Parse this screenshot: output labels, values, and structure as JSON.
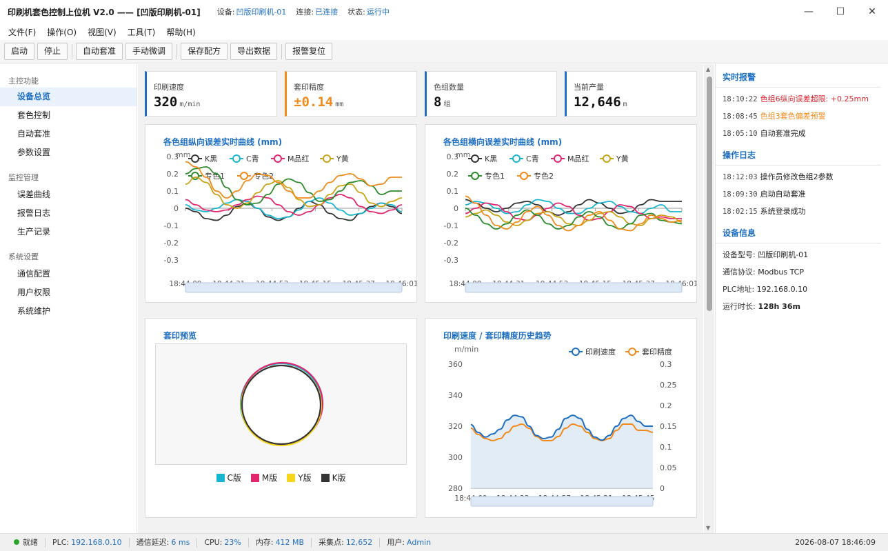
{
  "window": {
    "title": "印刷机套色控制上位机 V2.0 —— [凹版印刷机-01]",
    "device_label": "设备:",
    "device": "凹版印刷机-01",
    "conn_label": "连接:",
    "conn": "已连接",
    "state_label": "状态:",
    "state": "运行中",
    "min": "—",
    "max": "☐",
    "close": "✕"
  },
  "menu": [
    "文件(F)",
    "操作(O)",
    "视图(V)",
    "工具(T)",
    "帮助(H)"
  ],
  "toolbar": {
    "start": "启动",
    "stop": "停止",
    "auto": "自动套准",
    "manual": "手动微调",
    "save": "保存配方",
    "export": "导出数据",
    "reset": "报警复位"
  },
  "sidebar": {
    "g1": "主控功能",
    "i1": "设备总览",
    "i2": "套色控制",
    "i3": "自动套准",
    "i4": "参数设置",
    "g2": "监控管理",
    "i5": "误差曲线",
    "i6": "报警日志",
    "i7": "生产记录",
    "g3": "系统设置",
    "i8": "通信配置",
    "i9": "用户权限",
    "i10": "系统维护"
  },
  "kpis": [
    {
      "label": "印刷速度",
      "value": "320",
      "unit": "m/min",
      "color": "#1e6fc2",
      "value_color": "#111"
    },
    {
      "label": "套印精度",
      "value": "±0.14",
      "unit": "mm",
      "color": "#f08a1a",
      "value_color": "#f08a1a"
    },
    {
      "label": "色组数量",
      "value": "8",
      "unit": "组",
      "color": "#1e6fc2",
      "value_color": "#111"
    },
    {
      "label": "当前产量",
      "value": "12,646",
      "unit": "m",
      "color": "#1e6fc2",
      "value_color": "#111"
    }
  ],
  "chart_data": [
    {
      "type": "line",
      "title": "各色组纵向误差实时曲线 (mm)",
      "ylabel": "mm",
      "ylim": [
        -0.3,
        0.3
      ],
      "y_ticks": [
        "0.3",
        "0.2",
        "0.1",
        "0",
        "-0.1",
        "-0.2",
        "-0.3"
      ],
      "x_ticks": [
        "18:44:09",
        "18:44:31",
        "18:44:53",
        "18:45:15",
        "18:45:37",
        "18:46:01"
      ],
      "series_names": [
        "K黑",
        "C青",
        "M品红",
        "Y黄",
        "专色1",
        "专色2"
      ],
      "series_colors": [
        "#333333",
        "#19b4cf",
        "#e0266e",
        "#c9a317",
        "#2a8a2a",
        "#f08a1a"
      ],
      "series": [
        {
          "name": "K黑",
          "values": [
            0,
            -0.02,
            -0.06,
            -0.07,
            -0.04,
            0.01,
            0.03,
            0.0,
            -0.05,
            -0.07,
            -0.05,
            0.0,
            0.04,
            0.02,
            -0.03,
            -0.06,
            -0.07,
            -0.03,
            0.01,
            0.03,
            0.01,
            -0.03
          ]
        },
        {
          "name": "C青",
          "values": [
            0.02,
            -0.01,
            -0.02,
            0.0,
            0.03,
            0.05,
            0.04,
            0.0,
            -0.04,
            -0.06,
            -0.05,
            -0.01,
            0.04,
            0.06,
            0.03,
            -0.01,
            -0.04,
            -0.03,
            0.0,
            0.03,
            0.02,
            -0.02
          ]
        },
        {
          "name": "M品红",
          "values": [
            0.05,
            0.02,
            -0.01,
            -0.02,
            -0.01,
            0.02,
            0.05,
            0.07,
            0.06,
            0.02,
            -0.02,
            -0.04,
            -0.02,
            0.02,
            0.06,
            0.08,
            0.06,
            0.01,
            -0.02,
            -0.03,
            -0.01,
            0.02
          ]
        },
        {
          "name": "Y黄",
          "values": [
            0.14,
            0.18,
            0.15,
            0.08,
            0.02,
            0.0,
            0.03,
            0.09,
            0.14,
            0.16,
            0.12,
            0.05,
            0.01,
            0.02,
            0.08,
            0.13,
            0.14,
            0.09,
            0.03,
            0.01,
            0.04,
            0.06
          ]
        },
        {
          "name": "专色1",
          "values": [
            0.2,
            0.23,
            0.24,
            0.2,
            0.12,
            0.05,
            0.02,
            0.03,
            0.08,
            0.14,
            0.17,
            0.15,
            0.09,
            0.04,
            0.05,
            0.1,
            0.15,
            0.16,
            0.13,
            0.08,
            0.1,
            0.1
          ]
        },
        {
          "name": "专色2",
          "values": [
            0.27,
            0.24,
            0.18,
            0.1,
            0.06,
            0.1,
            0.16,
            0.2,
            0.19,
            0.15,
            0.1,
            0.06,
            0.06,
            0.1,
            0.15,
            0.19,
            0.2,
            0.17,
            0.13,
            0.14,
            0.18,
            0.18
          ]
        }
      ]
    },
    {
      "type": "line",
      "title": "各色组横向误差实时曲线 (mm)",
      "ylabel": "mm",
      "ylim": [
        -0.3,
        0.3
      ],
      "y_ticks": [
        "0.3",
        "0.2",
        "0.1",
        "0",
        "-0.1",
        "-0.2",
        "-0.3"
      ],
      "x_ticks": [
        "18:44:09",
        "18:44:31",
        "18:44:53",
        "18:45:15",
        "18:45:37",
        "18:46:01"
      ],
      "series_names": [
        "K黑",
        "C青",
        "M品红",
        "Y黄",
        "专色1",
        "专色2"
      ],
      "series_colors": [
        "#333333",
        "#19b4cf",
        "#e0266e",
        "#c9a317",
        "#2a8a2a",
        "#f08a1a"
      ],
      "series": [
        {
          "name": "K黑",
          "values": [
            0.05,
            0.03,
            0.0,
            -0.02,
            0.0,
            0.03,
            0.04,
            0.02,
            -0.02,
            -0.04,
            -0.02,
            0.02,
            0.05,
            0.03,
            0.0,
            -0.03,
            -0.02,
            0.02,
            0.05,
            0.04,
            0.04,
            0.04
          ]
        },
        {
          "name": "C青",
          "values": [
            0.02,
            0.04,
            0.03,
            0.0,
            -0.03,
            -0.02,
            0.02,
            0.05,
            0.04,
            0.0,
            -0.03,
            -0.03,
            0.0,
            0.03,
            0.04,
            0.01,
            -0.02,
            -0.03,
            0.0,
            0.02,
            -0.02,
            -0.02
          ]
        },
        {
          "name": "M品红",
          "values": [
            -0.03,
            0.0,
            0.03,
            0.02,
            -0.02,
            -0.06,
            -0.07,
            -0.04,
            0.0,
            0.03,
            0.01,
            -0.04,
            -0.07,
            -0.06,
            -0.02,
            0.02,
            0.01,
            -0.03,
            -0.06,
            -0.05,
            -0.06,
            -0.06
          ]
        },
        {
          "name": "Y黄",
          "values": [
            -0.05,
            -0.03,
            -0.01,
            -0.04,
            -0.08,
            -0.1,
            -0.07,
            -0.03,
            -0.02,
            -0.05,
            -0.09,
            -0.1,
            -0.07,
            -0.03,
            -0.02,
            -0.05,
            -0.09,
            -0.1,
            -0.06,
            -0.04,
            -0.05,
            -0.08
          ]
        },
        {
          "name": "专色1",
          "values": [
            0.0,
            -0.04,
            -0.09,
            -0.12,
            -0.09,
            -0.04,
            -0.01,
            -0.04,
            -0.09,
            -0.12,
            -0.1,
            -0.05,
            -0.02,
            -0.05,
            -0.1,
            -0.12,
            -0.09,
            -0.04,
            -0.03,
            -0.07,
            -0.08,
            -0.09
          ]
        },
        {
          "name": "专色2",
          "values": [
            0.07,
            0.03,
            -0.04,
            -0.1,
            -0.12,
            -0.08,
            -0.02,
            0.01,
            -0.04,
            -0.1,
            -0.13,
            -0.1,
            -0.04,
            -0.02,
            -0.07,
            -0.12,
            -0.13,
            -0.09,
            -0.04,
            -0.06,
            -0.08,
            -0.07
          ]
        }
      ]
    },
    {
      "type": "line",
      "title": "印刷速度 / 套印精度历史趋势",
      "ylabel": "m/min",
      "ylim": [
        280,
        360
      ],
      "y2lim": [
        0,
        0.3
      ],
      "y_ticks": [
        "360",
        "340",
        "320",
        "300",
        "280"
      ],
      "y2_ticks": [
        "0.3",
        "0.25",
        "0.2",
        "0.15",
        "0.1",
        "0.05",
        "0"
      ],
      "x_ticks": [
        "18:44:09",
        "18:44:33",
        "18:44:57",
        "18:45:21",
        "18:45:45"
      ],
      "series_names": [
        "印刷速度",
        "套印精度"
      ],
      "series_colors": [
        "#1e6fc2",
        "#f08a1a"
      ],
      "series": [
        {
          "name": "印刷速度",
          "axis": "left",
          "values": [
            321,
            316,
            313,
            315,
            318,
            324,
            327,
            326,
            320,
            314,
            312,
            313,
            318,
            325,
            327,
            325,
            318,
            313,
            311,
            314,
            320,
            325,
            327,
            323,
            320,
            320
          ]
        },
        {
          "name": "套印精度",
          "axis": "right",
          "values": [
            0.145,
            0.13,
            0.12,
            0.115,
            0.12,
            0.135,
            0.15,
            0.155,
            0.145,
            0.125,
            0.115,
            0.115,
            0.125,
            0.145,
            0.155,
            0.15,
            0.135,
            0.12,
            0.115,
            0.12,
            0.14,
            0.155,
            0.155,
            0.14,
            0.14,
            0.135
          ]
        }
      ]
    }
  ],
  "preview": {
    "title": "套印预览",
    "legend": [
      "C版",
      "M版",
      "Y版",
      "K版"
    ],
    "colors": [
      "#19b4cf",
      "#e0266e",
      "#f5d51e",
      "#333333"
    ]
  },
  "realtime": {
    "title": "实时报警",
    "rows": [
      {
        "time": "18:10:22",
        "text": "色组6纵向误差超限: +0.25mm",
        "color": "#d9262e"
      },
      {
        "time": "18:08:45",
        "text": "色组3套色偏差预警",
        "color": "#f08a1a"
      },
      {
        "time": "18:05:10",
        "text": "自动套准完成",
        "color": "#222"
      }
    ]
  },
  "oplog": {
    "title": "操作日志",
    "rows": [
      {
        "time": "18:12:03",
        "text": "操作员修改色组2参数"
      },
      {
        "time": "18:09:30",
        "text": "启动自动套准"
      },
      {
        "time": "18:02:15",
        "text": "系统登录成功"
      }
    ]
  },
  "devinfo": {
    "title": "设备信息",
    "rows": [
      {
        "k": "设备型号:",
        "v": "凹版印刷机-01",
        "bold": false
      },
      {
        "k": "通信协议:",
        "v": "Modbus TCP",
        "bold": false
      },
      {
        "k": "PLC地址:",
        "v": "192.168.0.10",
        "bold": false
      },
      {
        "k": "运行时长:",
        "v": "128h 36m",
        "bold": true
      }
    ]
  },
  "status": {
    "ready": "就绪",
    "plc_label": "PLC:",
    "plc": "192.168.0.10",
    "lat_label": "通信延迟:",
    "lat": "6 ms",
    "cpu_label": "CPU:",
    "cpu": "23%",
    "mem_label": "内存:",
    "mem": "412 MB",
    "pts_label": "采集点:",
    "pts": "12,652",
    "user_label": "用户:",
    "user": "Admin",
    "datetime": "2026-08-07 18:46:09"
  }
}
